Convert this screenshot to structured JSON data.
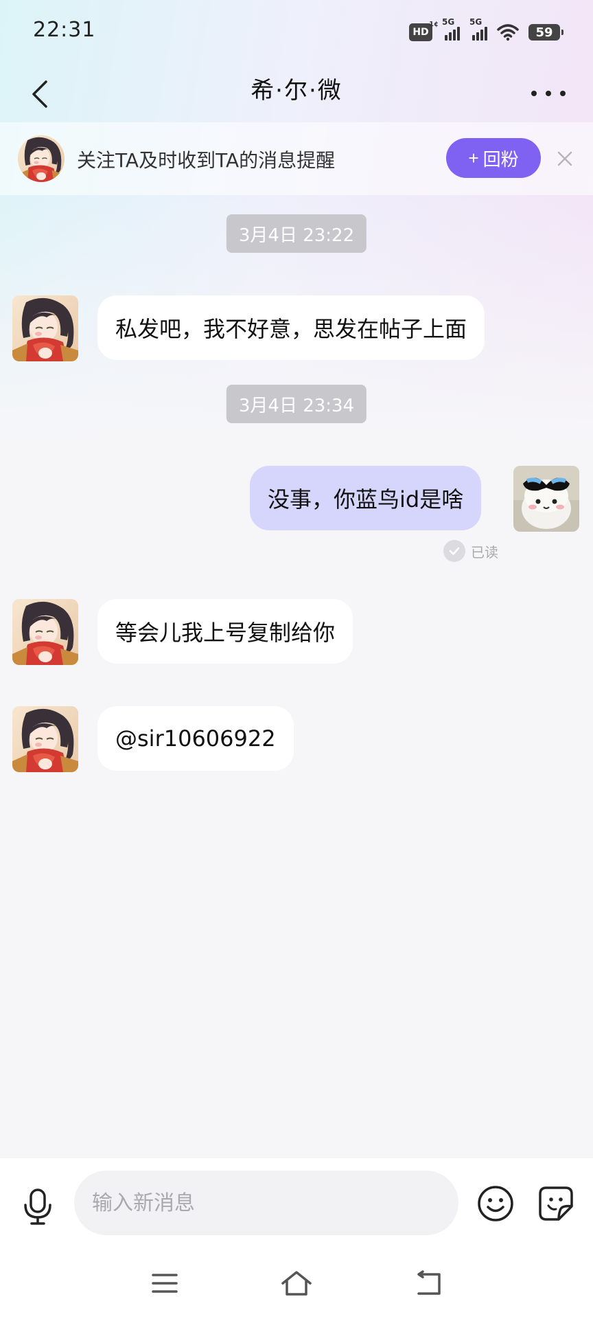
{
  "status_bar": {
    "time": "22:31",
    "network_1": "5G",
    "network_2": "5G",
    "hd_label": "HD",
    "battery": "59"
  },
  "header": {
    "title": "希·尔·微",
    "back_icon": "chevron-left-icon",
    "more_icon": "more-dots-icon"
  },
  "follow_banner": {
    "text": "关注TA及时收到TA的消息提醒",
    "button_plus": "+",
    "button_label": "回粉",
    "close_icon": "close-icon",
    "accent_color": "#7f62f2"
  },
  "messages": [
    {
      "type": "timestamp",
      "text": "3月4日 23:22"
    },
    {
      "type": "incoming",
      "text": "私发吧，我不好意，思发在帖子上面"
    },
    {
      "type": "timestamp",
      "text": "3月4日 23:34"
    },
    {
      "type": "outgoing",
      "text": "没事，你蓝鸟id是啥",
      "read_status": "已读"
    },
    {
      "type": "incoming",
      "text": "等会儿我上号复制给你"
    },
    {
      "type": "incoming",
      "text": "@sir10606922"
    }
  ],
  "input_bar": {
    "placeholder": "输入新消息",
    "mic_icon": "microphone-icon",
    "emoji_icon": "smiley-icon",
    "sticker_icon": "sticker-icon"
  },
  "nav_bar": {
    "menu_icon": "menu-icon",
    "home_icon": "home-icon",
    "back_icon": "back-arrow-icon"
  }
}
